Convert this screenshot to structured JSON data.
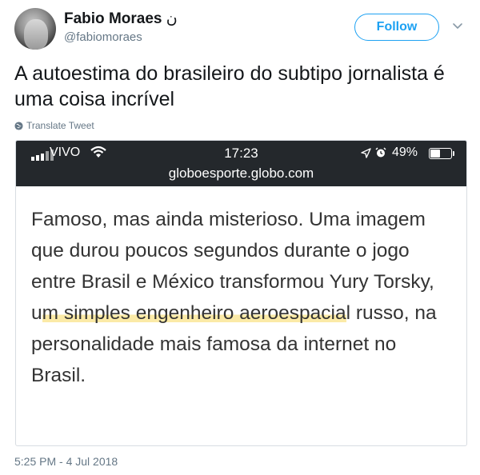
{
  "user": {
    "name": "Fabio Moraes",
    "name_glyph": "ن",
    "handle": "@fabiomoraes",
    "follow_label": "Follow"
  },
  "tweet": {
    "text": "A autoestima do brasileiro do subtipo jornalista é uma coisa incrível",
    "translate_label": "Translate Tweet",
    "timestamp": "5:25 PM - 4 Jul 2018"
  },
  "embedded_screenshot": {
    "status_bar": {
      "carrier": "VIVO",
      "time": "17:23",
      "battery": "49%",
      "battery_level": 0.49
    },
    "url": "globoesporte.globo.com",
    "article": {
      "before_highlight": "Famoso, mas ainda misterioso. Uma imagem que durou poucos segundos durante o jogo entre Brasil e México transformou Yury Torsky, u",
      "highlight": "m simples engenheiro aeroespacia",
      "after_highlight": "l russo, na personalidade mais famosa da internet no Brasil."
    }
  },
  "colors": {
    "accent": "#1da1f2",
    "secondary_text": "#657786",
    "status_bar_bg": "#24282c",
    "highlight": "#fbeaa7"
  }
}
